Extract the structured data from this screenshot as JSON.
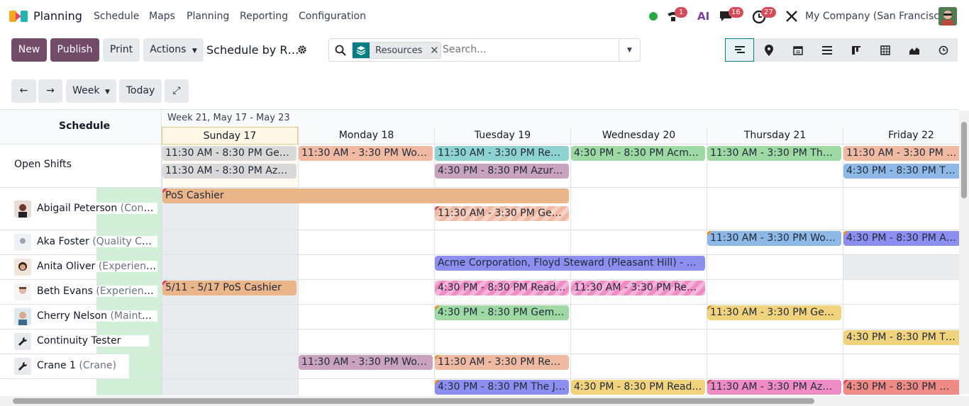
{
  "app": {
    "name": "Planning",
    "menu": [
      "Schedule",
      "Maps",
      "Planning",
      "Reporting",
      "Configuration"
    ],
    "badges": {
      "activity": "1",
      "messages": "16",
      "clock": "27"
    },
    "ai_label": "AI",
    "company": "My Company (San Francisco)"
  },
  "control": {
    "new": "New",
    "publish": "Publish",
    "print": "Print",
    "actions": "Actions",
    "title": "Schedule by R…",
    "facet": "Resources",
    "search_placeholder": "Search..."
  },
  "views": [
    "gantt",
    "map",
    "calendar",
    "list",
    "kanban",
    "pivot",
    "graph",
    "activity"
  ],
  "toolbar": {
    "scale": "Week",
    "today": "Today"
  },
  "gantt": {
    "header": "Schedule",
    "week": "Week 21, May 17 - May 23",
    "days": [
      "Sunday 17",
      "Monday 18",
      "Tuesday 19",
      "Wednesday 20",
      "Thursday 21",
      "Friday 22"
    ],
    "rows": [
      {
        "name": "Open Shifts",
        "role": ""
      },
      {
        "name": "Abigail Peterson",
        "role": "(Consul…"
      },
      {
        "name": "Aka Foster",
        "role": "(Quality Cont…"
      },
      {
        "name": "Anita Oliver",
        "role": "(Experience…"
      },
      {
        "name": "Beth Evans",
        "role": "(Experienced…"
      },
      {
        "name": "Cherry Nelson",
        "role": "(Maintena…"
      },
      {
        "name": "Continuity Tester",
        "role": ""
      },
      {
        "name": "Crane 1",
        "role": "(Crane)"
      }
    ],
    "shifts": [
      "11:30 AM - 8:30 PM Gemini…",
      "11:30 AM - 8:30 PM Azure I…",
      "11:30 AM - 3:30 PM Wood …",
      "11:30 AM - 3:30 PM Ready …",
      "4:30 PM - 8:30 PM Azure In…",
      "4:30 PM - 8:30 PM Acme C…",
      "11:30 AM - 3:30 PM The Ja…",
      "11:30 AM - 3:30 PM Ready",
      "4:30 PM - 8:30 PM The Jac",
      "PoS Cashier",
      "11:30 AM - 3:30 PM Gemini…",
      "11:30 AM - 3:30 PM Wood …",
      "4:30 PM - 8:30 PM Azure I",
      "Acme Corporation, Floyd Steward (Pleasant Hill) - Applian…",
      "5/11 - 5/17 PoS Cashier",
      "4:30 PM - 8:30 PM Ready …",
      "11:30 AM - 3:30 PM Ready …",
      "4:30 PM - 8:30 PM Gemini …",
      "11:30 AM - 3:30 PM Gemini…",
      "4:30 PM - 8:30 PM The Ja",
      "11:30 AM - 3:30 PM Wood …",
      "11:30 AM - 3:30 PM Ready …",
      "4:30 PM - 8:30 PM The Jac…",
      "4:30 PM - 8:30 PM Ready …",
      "11:30 AM - 3:30 PM Azure I…",
      "4:30 PM - 8:30 PM Wood"
    ]
  }
}
